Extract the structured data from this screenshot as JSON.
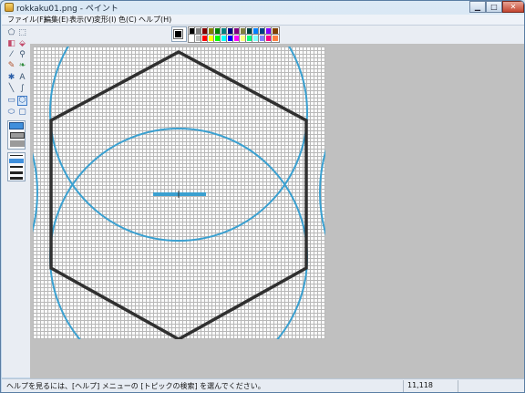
{
  "window": {
    "title": "rokkaku01.png - ペイント"
  },
  "menus": [
    "ファイル(F)",
    "編集(E)",
    "表示(V)",
    "変形(I)",
    "色(C)",
    "ヘルプ(H)"
  ],
  "tools": [
    {
      "name": "free-select",
      "glyph": "⬠"
    },
    {
      "name": "rect-select",
      "glyph": "⬚"
    },
    {
      "name": "eraser",
      "glyph": "◧"
    },
    {
      "name": "fill",
      "glyph": "⬙"
    },
    {
      "name": "color-picker",
      "glyph": "⁄"
    },
    {
      "name": "magnifier",
      "glyph": "⚲"
    },
    {
      "name": "pencil",
      "glyph": "✎"
    },
    {
      "name": "brush",
      "glyph": "❧"
    },
    {
      "name": "airbrush",
      "glyph": "✱"
    },
    {
      "name": "text",
      "glyph": "A"
    },
    {
      "name": "line",
      "glyph": "╲"
    },
    {
      "name": "curve",
      "glyph": "∫"
    },
    {
      "name": "rectangle",
      "glyph": "▭"
    },
    {
      "name": "polygon",
      "glyph": "⬡"
    },
    {
      "name": "ellipse",
      "glyph": "⬭"
    },
    {
      "name": "rounded-rect",
      "glyph": "▢"
    }
  ],
  "palette": {
    "primary": "#000000",
    "secondary": "#ffffff",
    "row1": [
      "#000000",
      "#808080",
      "#800000",
      "#808000",
      "#008000",
      "#008080",
      "#000080",
      "#800080",
      "#808040",
      "#004040",
      "#0080ff",
      "#004080",
      "#8000ff",
      "#804000"
    ],
    "row2": [
      "#ffffff",
      "#c0c0c0",
      "#ff0000",
      "#ffff00",
      "#00ff00",
      "#00ffff",
      "#0000ff",
      "#ff00ff",
      "#ffff80",
      "#00ff80",
      "#80ffff",
      "#8080ff",
      "#ff0080",
      "#ff8040"
    ]
  },
  "canvas": {
    "accent_blue": "#3aa0d0",
    "stroke_dark": "#303030"
  },
  "status": {
    "help_text": "ヘルプを見るには、[ヘルプ] メニューの [トピックの検索] を選んでください。",
    "coordinates": "11,118"
  }
}
